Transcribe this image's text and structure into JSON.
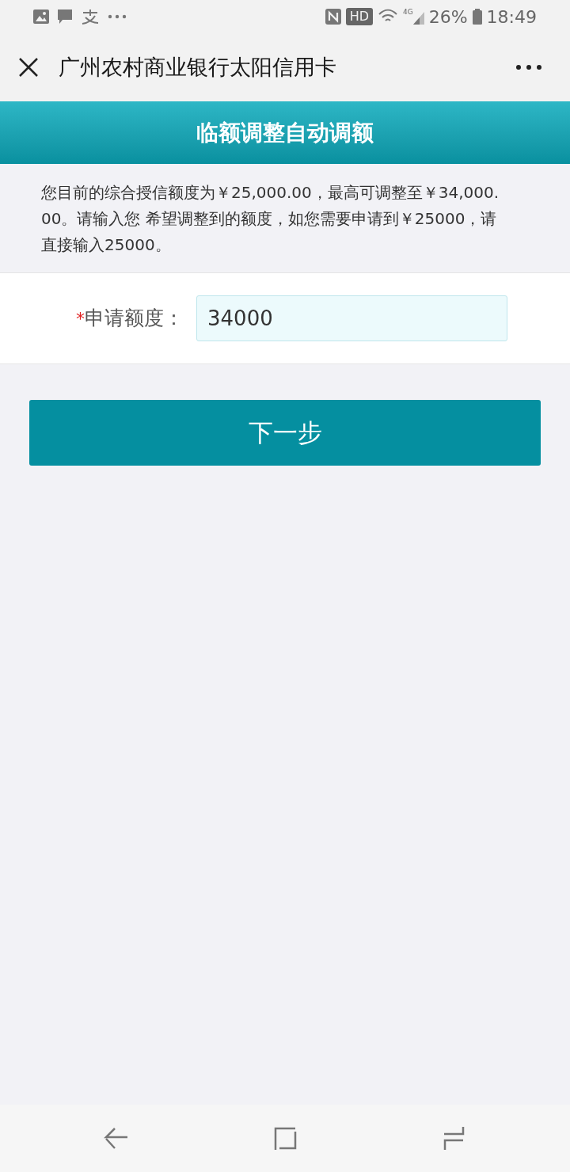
{
  "status_bar": {
    "badge": "HD",
    "network": "4G",
    "battery": "26%",
    "time": "18:49"
  },
  "nav": {
    "title": "广州农村商业银行太阳信用卡"
  },
  "header": {
    "title": "临额调整自动调额"
  },
  "info": "您目前的综合授信额度为￥25,000.00，最高可调整至￥34,000.00。请输入您 希望调整到的额度，如您需要申请到￥25000，请直接输入25000。",
  "form": {
    "required_mark": "*",
    "label": "申请额度：",
    "value": "34000"
  },
  "next_button": "下一步"
}
